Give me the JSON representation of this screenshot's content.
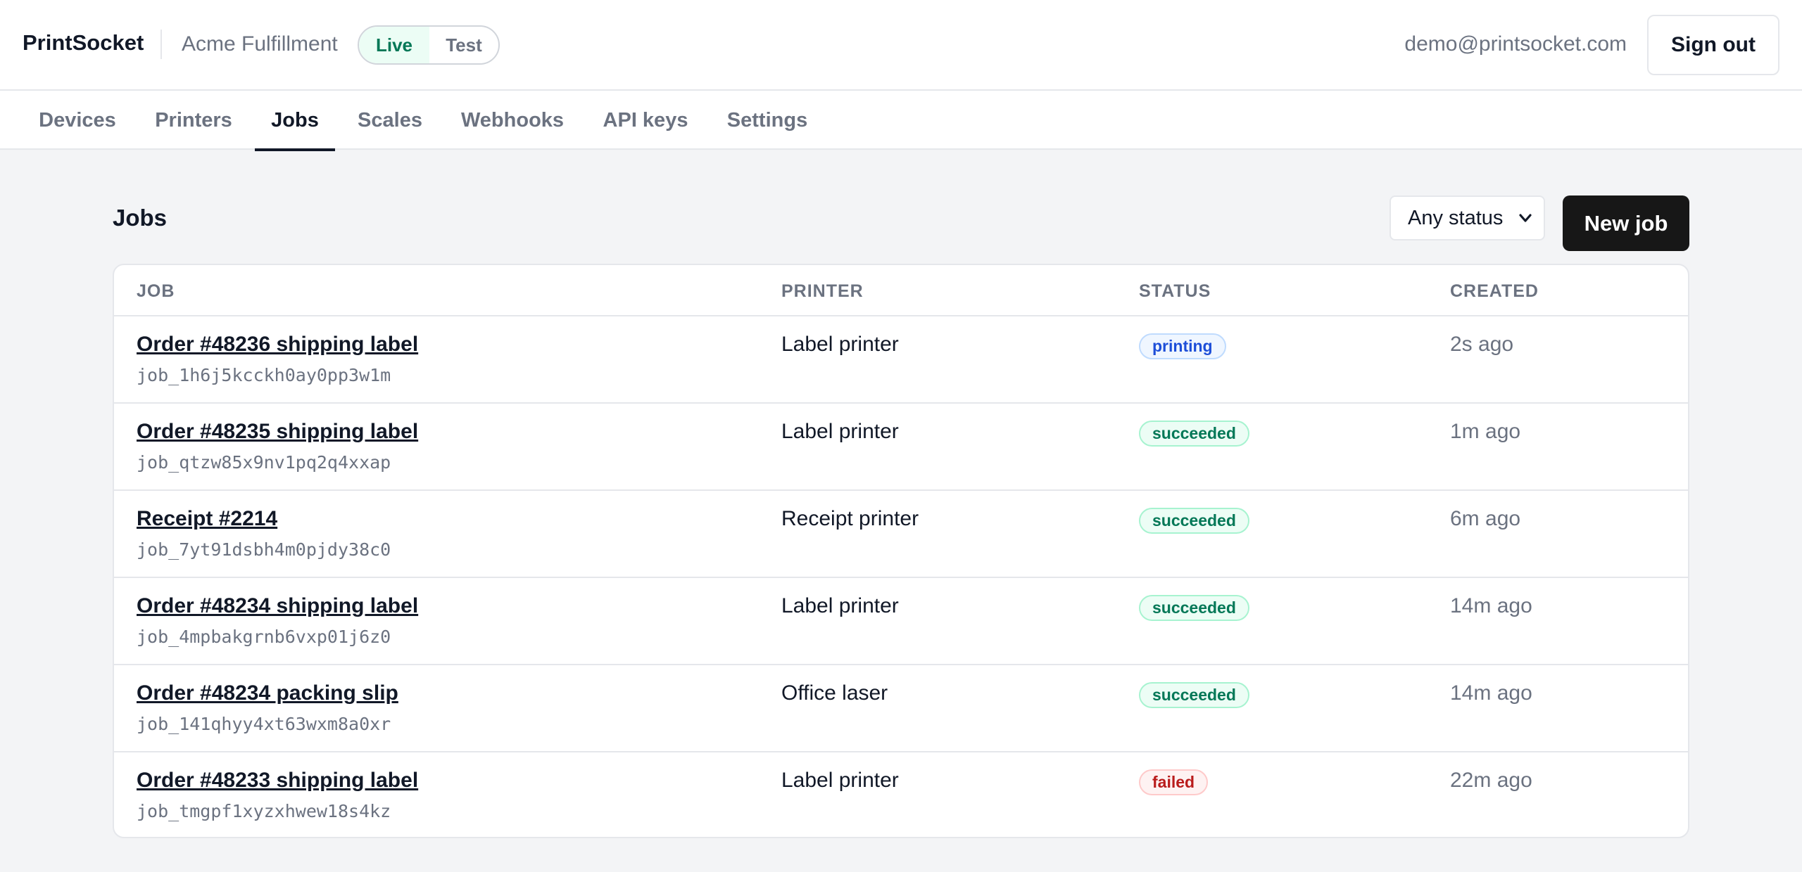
{
  "app": {
    "brand": "PrintSocket",
    "organization": "Acme Fulfillment",
    "mode_toggle": {
      "live": "Live",
      "test": "Test",
      "selected": "Live"
    },
    "user_email": "demo@printsocket.com",
    "sign_out_label": "Sign out"
  },
  "tabs": [
    {
      "label": "Devices",
      "active": false
    },
    {
      "label": "Printers",
      "active": false
    },
    {
      "label": "Jobs",
      "active": true
    },
    {
      "label": "Scales",
      "active": false
    },
    {
      "label": "Webhooks",
      "active": false
    },
    {
      "label": "API keys",
      "active": false
    },
    {
      "label": "Settings",
      "active": false
    }
  ],
  "page": {
    "title": "Jobs",
    "status_filter": {
      "selected": "Any status",
      "icon": "chevron-down-icon"
    },
    "new_job_label": "New job"
  },
  "table": {
    "columns": [
      "JOB",
      "PRINTER",
      "STATUS",
      "CREATED"
    ],
    "rows": [
      {
        "title": "Order #48236 shipping label",
        "id": "job_1h6j5kcckh0ay0pp3w1m",
        "printer": "Label printer",
        "status": "printing",
        "created": "2s ago"
      },
      {
        "title": "Order #48235 shipping label",
        "id": "job_qtzw85x9nv1pq2q4xxap",
        "printer": "Label printer",
        "status": "succeeded",
        "created": "1m ago"
      },
      {
        "title": "Receipt #2214",
        "id": "job_7yt91dsbh4m0pjdy38c0",
        "printer": "Receipt printer",
        "status": "succeeded",
        "created": "6m ago"
      },
      {
        "title": "Order #48234 shipping label",
        "id": "job_4mpbakgrnb6vxp01j6z0",
        "printer": "Label printer",
        "status": "succeeded",
        "created": "14m ago"
      },
      {
        "title": "Order #48234 packing slip",
        "id": "job_141qhyy4xt63wxm8a0xr",
        "printer": "Office laser",
        "status": "succeeded",
        "created": "14m ago"
      },
      {
        "title": "Order #48233 shipping label",
        "id": "job_tmgpf1xyzxhwew18s4kz",
        "printer": "Label printer",
        "status": "failed",
        "created": "22m ago"
      }
    ]
  },
  "colors": {
    "accent_dark": "#171717",
    "live_green": "#047857",
    "status_printing": "#1d4ed8",
    "status_succeeded": "#047857",
    "status_failed": "#b91c1c"
  }
}
